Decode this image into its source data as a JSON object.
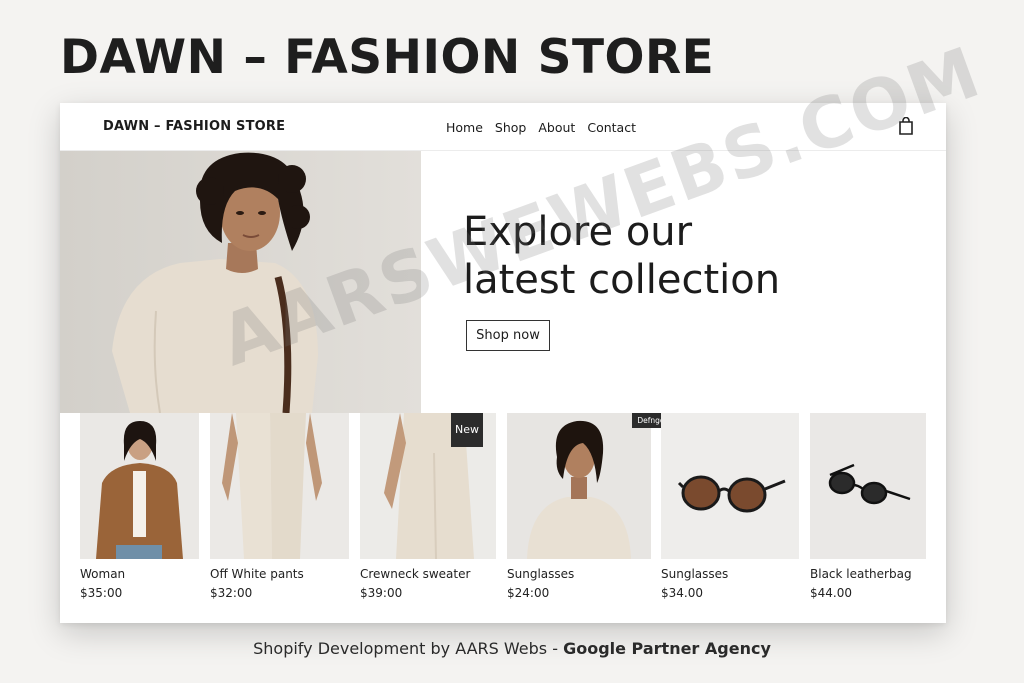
{
  "page_title": "DAWN – FASHION STORE",
  "store": {
    "brand": "DAWN – FASHION STORE",
    "nav": [
      "Home",
      "Shop",
      "About",
      "Contact"
    ],
    "cart_icon": "shopping-bag-icon",
    "hero": {
      "line1": "Explore our",
      "line2": "latest collection",
      "button": "Shop now"
    },
    "products": [
      {
        "name": "Woman",
        "price": "$35:00"
      },
      {
        "name": "Off White pants",
        "price": "$32:00"
      },
      {
        "name": "Crewneck sweater",
        "price": "$39:00",
        "badge": "New"
      },
      {
        "name": "Sunglasses",
        "price": "$24:00",
        "badge": "Defnge Inu"
      },
      {
        "name": "Sunglasses",
        "price": "$34.00"
      },
      {
        "name": "Black leatherbag",
        "price": "$44.00"
      }
    ]
  },
  "watermark": "AARSWEWEBS.COM",
  "footer": {
    "text": "Shopify Development by AARS Webs - ",
    "strong": "Google Partner Agency"
  },
  "colors": {
    "background": "#f4f3f1",
    "badge": "#2c2c2c",
    "text": "#1c1c1c"
  }
}
